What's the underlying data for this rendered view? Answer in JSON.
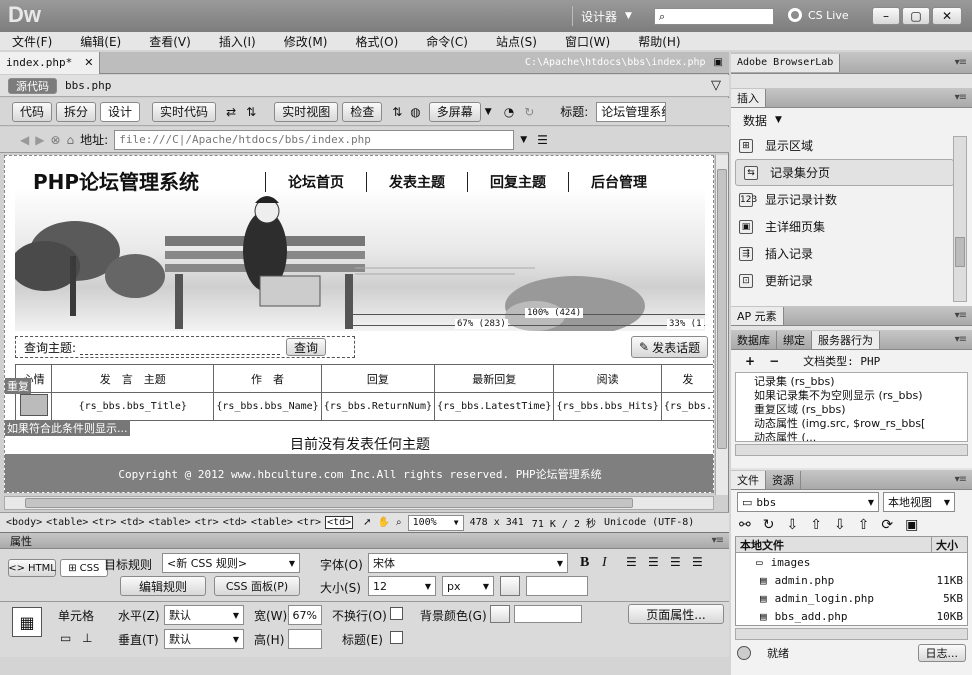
{
  "app": {
    "logo": "Dw",
    "workspace": "设计器",
    "cslive": "CS Live"
  },
  "menu": [
    "文件(F)",
    "编辑(E)",
    "查看(V)",
    "插入(I)",
    "修改(M)",
    "格式(O)",
    "命令(C)",
    "站点(S)",
    "窗口(W)",
    "帮助(H)"
  ],
  "doc": {
    "tab_label": "index.php*",
    "path": "C:\\Apache\\htdocs\\bbs\\index.php",
    "source_badge": "源代码",
    "related_file": "bbs.php"
  },
  "toolbar": {
    "code": "代码",
    "split": "拆分",
    "design": "设计",
    "live_code": "实时代码",
    "live_view": "实时视图",
    "inspect": "检查",
    "multiscreen": "多屏幕",
    "title_label": "标题:",
    "title_value": "论坛管理系统"
  },
  "address": {
    "label": "地址:",
    "value": "file:///C|/Apache/htdocs/bbs/index.php"
  },
  "page": {
    "site_title": "PHP论坛管理系统",
    "nav": [
      "论坛首页",
      "发表主题",
      "回复主题",
      "后台管理"
    ],
    "ruler": {
      "main": "100% (424)",
      "left": "67% (283)",
      "right": "33% (1"
    },
    "search_label": "查询主题:",
    "search_button": "查询",
    "post_button": "发表话题",
    "table_headers": [
      "心情",
      "发　言　主题",
      "作　者",
      "回复",
      "最新回复",
      "阅读",
      "发"
    ],
    "repeat_tag": "重复",
    "row_cells": [
      "{rs_bbs.bbs_Title}",
      "{rs_bbs.bbs_Name}",
      "{rs_bbs.ReturnNum}",
      "{rs_bbs.LatestTime}",
      "{rs_bbs.bbs_Hits}",
      "{rs_bbs."
    ],
    "cond_tag": "如果符合此条件则显示...",
    "no_topics": "目前没有发表任何主题",
    "copyright": "Copyright @ 2012 www.hbculture.com Inc.All rights reserved. PHP论坛管理系统"
  },
  "status": {
    "tags": [
      "<body>",
      "<table>",
      "<tr>",
      "<td>",
      "<table>",
      "<tr>",
      "<td>",
      "<table>",
      "<tr>",
      "<td>"
    ],
    "zoom": "100%",
    "size": "478 x 341",
    "weight": "71 K / 2 秒",
    "encoding": "Unicode (UTF-8)"
  },
  "properties": {
    "title": "属性",
    "html_tab": "HTML",
    "css_tab": "CSS",
    "target_rule_label": "目标规则",
    "target_rule_value": "<新 CSS 规则>",
    "edit_rule": "编辑规则",
    "css_panel": "CSS 面板(P)",
    "font_label": "字体(O)",
    "font_value": "宋体",
    "size_label": "大小(S)",
    "size_value": "12",
    "size_unit": "px",
    "cell_label": "单元格",
    "horz_label": "水平(Z)",
    "horz_value": "默认",
    "vert_label": "垂直(T)",
    "vert_value": "默认",
    "width_label": "宽(W)",
    "width_value": "67%",
    "height_label": "高(H)",
    "height_value": "",
    "nowrap_label": "不换行(O)",
    "header_label": "标题(E)",
    "bg_label": "背景颜色(G)",
    "page_props": "页面属性..."
  },
  "browserlab": {
    "title": "Adobe BrowserLab"
  },
  "insert_panel": {
    "tab": "插入",
    "category": "数据",
    "items": [
      "显示区域",
      "记录集分页",
      "显示记录计数",
      "主详细页集",
      "插入记录",
      "更新记录"
    ]
  },
  "ap_panel": {
    "tab": "AP 元素"
  },
  "server_panel": {
    "tabs": [
      "数据库",
      "绑定",
      "服务器行为"
    ],
    "doc_type": "文档类型: PHP",
    "behaviors": [
      "记录集 (rs_bbs)",
      "如果记录集不为空则显示 (rs_bbs)",
      "重复区域 (rs_bbs)",
      "动态属性 (img.src, $row_rs_bbs[",
      "动态属性 (..."
    ]
  },
  "files_panel": {
    "tabs": [
      "文件",
      "资源"
    ],
    "site": "bbs",
    "view": "本地视图",
    "col_name": "本地文件",
    "col_size": "大小",
    "files": [
      {
        "name": "images",
        "size": ""
      },
      {
        "name": "admin.php",
        "size": "11KB"
      },
      {
        "name": "admin_login.php",
        "size": "5KB"
      },
      {
        "name": "bbs_add.php",
        "size": "10KB"
      }
    ],
    "status": "就绪",
    "log_button": "日志..."
  }
}
